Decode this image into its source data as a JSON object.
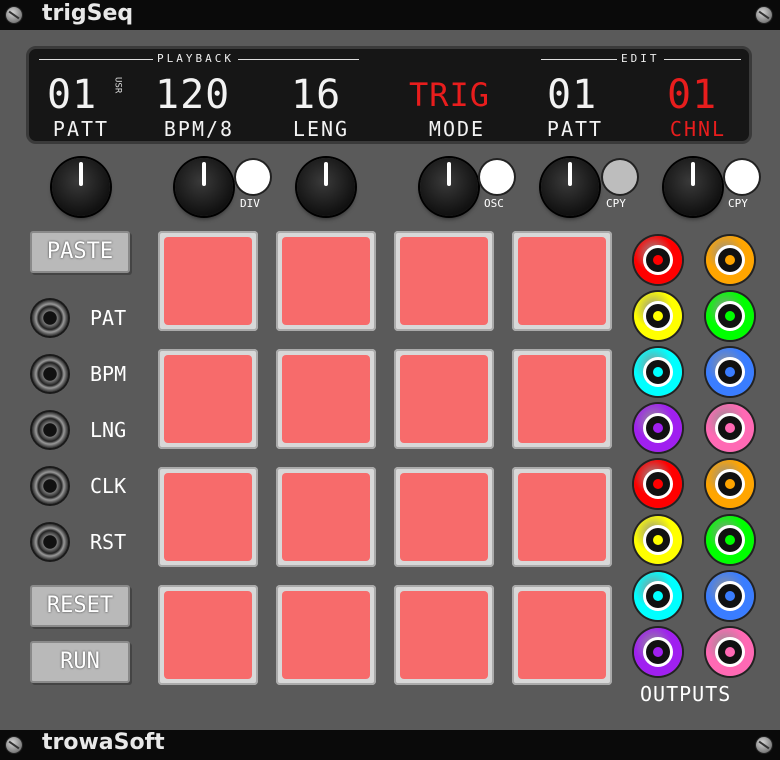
{
  "module": {
    "title": "trigSeq",
    "brand": "trowaSoft"
  },
  "display": {
    "playback_label": "PLAYBACK",
    "edit_label": "EDIT",
    "pattern": {
      "value": "01",
      "sub": "USR",
      "caption": "PATT"
    },
    "bpm": {
      "value": "120",
      "caption": "BPM/8"
    },
    "length": {
      "value": "16",
      "caption": "LENG"
    },
    "mode": {
      "value": "TRIG",
      "caption": "MODE",
      "color": "#e81d1d"
    },
    "edit_pattern": {
      "value": "01",
      "caption": "PATT"
    },
    "channel": {
      "value": "01",
      "caption": "CHNL",
      "color": "#e81d1d"
    }
  },
  "controls": {
    "div_label": "DIV",
    "osc_label": "OSC",
    "copy_pattern_label": "CPY",
    "copy_channel_label": "CPY"
  },
  "buttons": {
    "paste": "PASTE",
    "reset": "RESET",
    "run": "RUN"
  },
  "inputs": [
    "PAT",
    "BPM",
    "LNG",
    "CLK",
    "RST"
  ],
  "pads": {
    "rows": 4,
    "cols": 4,
    "active_color": "#f76b6b"
  },
  "outputs": {
    "label": "OUTPUTS",
    "colors": [
      "#ff0000",
      "#ffa500",
      "#ffff00",
      "#00ff00",
      "#00ffff",
      "#3a7dff",
      "#a020f0",
      "#ff69b4",
      "#ff0000",
      "#ffa500",
      "#ffff00",
      "#00ff00",
      "#00ffff",
      "#3a7dff",
      "#a020f0",
      "#ff69b4"
    ]
  }
}
